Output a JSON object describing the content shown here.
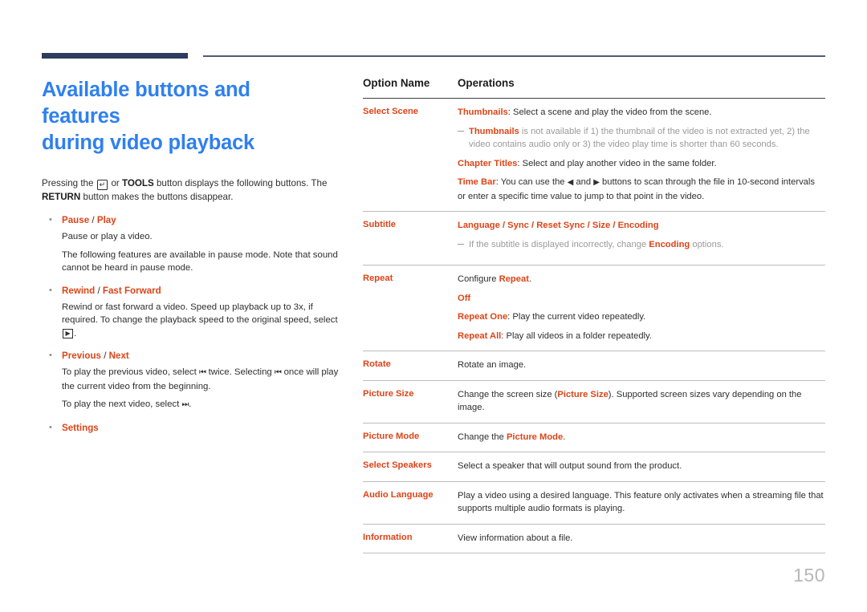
{
  "colors": {
    "title_blue": "#2f80ef",
    "accent_orange": "#dc4417",
    "rule_navy": "#2e3c5d",
    "note_gray": "#9a9a9a",
    "page_number_gray": "#b7b7b7"
  },
  "document": {
    "title_line1": "Available buttons and features",
    "title_line2": "during video playback",
    "page_number": "150"
  },
  "intro": {
    "part1": "Pressing the ",
    "key_icon": "enter-key-icon",
    "key_icon_glyph": "↵",
    "part2": " or ",
    "tools_label": "TOOLS",
    "part3": " button displays the following buttons. The ",
    "return_label": "RETURN",
    "part4": " button makes the buttons disappear."
  },
  "bullets": [
    {
      "head_primary": "Pause",
      "head_sep": " / ",
      "head_secondary": "Play",
      "lines": [
        "Pause or play a video.",
        "The following features are available in pause mode. Note that sound cannot be heard in pause mode."
      ]
    },
    {
      "head_primary": "Rewind",
      "head_sep": " / ",
      "head_secondary": "Fast Forward",
      "lines": [],
      "rich": {
        "pre": "Rewind or fast forward a video. Speed up playback up to 3x, if required. To change the playback speed to the original speed, select ",
        "glyph": "▶",
        "glyph_name": "play-button-icon",
        "post": "."
      }
    },
    {
      "head_primary": "Previous",
      "head_sep": " / ",
      "head_secondary": "Next",
      "lines": [],
      "rich2": {
        "a_pre": "To play the previous video, select ",
        "a_glyph": "⏮",
        "a_mid": " twice. Selecting ",
        "a_glyph2": "⏮",
        "a_post": " once will play the current video from the beginning.",
        "b_pre": "To play the next video, select ",
        "b_glyph": "⏭",
        "b_post": "."
      }
    },
    {
      "head_primary": "Settings",
      "head_sep": "",
      "head_secondary": "",
      "lines": []
    }
  ],
  "table": {
    "header": {
      "col1": "Option Name",
      "col2": "Operations"
    },
    "rows": [
      {
        "name": "Select Scene",
        "blocks": [
          {
            "type": "text",
            "em": "Thumbnails",
            "rest": ": Select a scene and play the video from the scene."
          },
          {
            "type": "note",
            "em": "Thumbnails",
            "rest": " is not available if 1) the thumbnail of the video is not extracted yet, 2) the video contains audio only or 3) the video play time is shorter than 60 seconds."
          },
          {
            "type": "text",
            "em": "Chapter Titles",
            "rest": ": Select and play another video in the same folder."
          },
          {
            "type": "timebar",
            "em": "Time Bar",
            "rest_a": ": You can use the ",
            "glyph_left": "◀",
            "rest_b": " and ",
            "glyph_right": "▶",
            "rest_c": " buttons to scan through the file in 10-second intervals or enter a specific time value to jump to that point in the video."
          }
        ]
      },
      {
        "name": "Subtitle",
        "blocks": [
          {
            "type": "allem",
            "em": "Language / Sync / Reset Sync / Size / Encoding",
            "rest": ""
          },
          {
            "type": "note",
            "pre": "If the subtitle is displayed incorrectly, change ",
            "em": "Encoding",
            "rest": " options."
          }
        ]
      },
      {
        "name": "Repeat",
        "blocks": [
          {
            "type": "pretext",
            "pre": "Configure ",
            "em": "Repeat",
            "rest": "."
          },
          {
            "type": "allem",
            "em": "Off",
            "rest": ""
          },
          {
            "type": "text",
            "em": "Repeat One",
            "rest": ": Play the current video repeatedly."
          },
          {
            "type": "text",
            "em": "Repeat All",
            "rest": ": Play all videos in a folder repeatedly."
          }
        ]
      },
      {
        "name": "Rotate",
        "blocks": [
          {
            "type": "plain",
            "rest": "Rotate an image."
          }
        ]
      },
      {
        "name": "Picture Size",
        "blocks": [
          {
            "type": "pretext",
            "pre": "Change the screen size (",
            "em": "Picture Size",
            "rest": "). Supported screen sizes vary depending on the image."
          }
        ]
      },
      {
        "name": "Picture Mode",
        "blocks": [
          {
            "type": "pretext",
            "pre": "Change the ",
            "em": "Picture Mode",
            "rest": "."
          }
        ]
      },
      {
        "name": "Select Speakers",
        "blocks": [
          {
            "type": "plain",
            "rest": "Select a speaker that will output sound from the product."
          }
        ]
      },
      {
        "name": "Audio Language",
        "blocks": [
          {
            "type": "plain",
            "rest": "Play a video using a desired language. This feature only activates when a streaming file that supports multiple audio formats is playing."
          }
        ]
      },
      {
        "name": "Information",
        "blocks": [
          {
            "type": "plain",
            "rest": "View information about a file."
          }
        ]
      }
    ]
  }
}
